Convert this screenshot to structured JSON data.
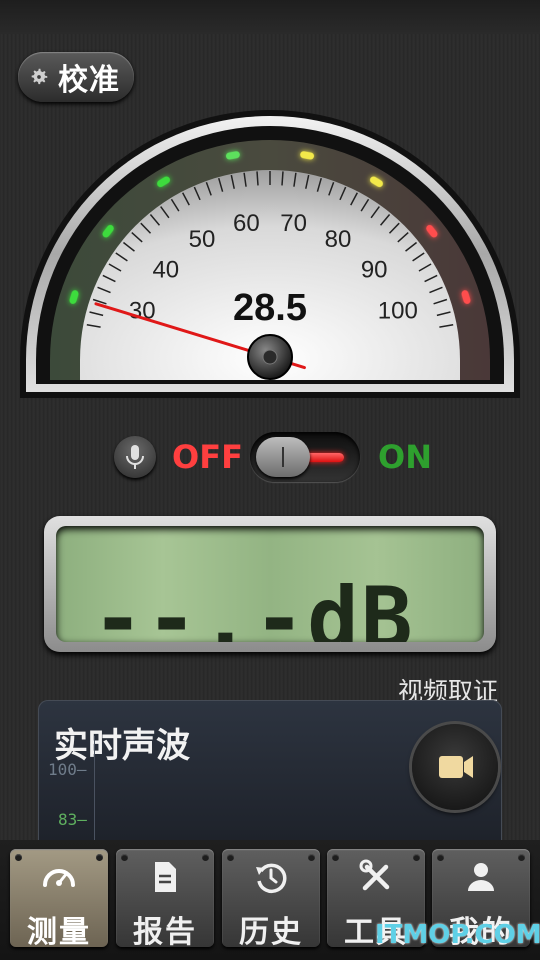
{
  "header": {
    "calibrate_label": "校准"
  },
  "gauge": {
    "reading": "28.5",
    "needle_value": 28.5,
    "scale_labels": [
      "30",
      "40",
      "50",
      "60",
      "70",
      "80",
      "90",
      "100"
    ],
    "scale_min": 25,
    "scale_max": 105
  },
  "switch": {
    "off_label": "OFF",
    "on_label": "ON",
    "state": "on"
  },
  "lcd": {
    "display": "--.-dB"
  },
  "video": {
    "label": "视频取证"
  },
  "realtime": {
    "title": "实时声波",
    "tick_top": "100",
    "tick_second": "83"
  },
  "tabs": [
    {
      "label": "测量",
      "icon": "speedometer-icon",
      "active": true
    },
    {
      "label": "报告",
      "icon": "document-icon",
      "active": false
    },
    {
      "label": "历史",
      "icon": "history-icon",
      "active": false
    },
    {
      "label": "工具",
      "icon": "tools-icon",
      "active": false
    },
    {
      "label": "我的",
      "icon": "user-icon",
      "active": false
    }
  ],
  "watermark": "ITMOP.COM",
  "colors": {
    "off_red": "#ff3f3f",
    "on_green": "#2ea02e",
    "lcd_green": "#a7c595"
  }
}
